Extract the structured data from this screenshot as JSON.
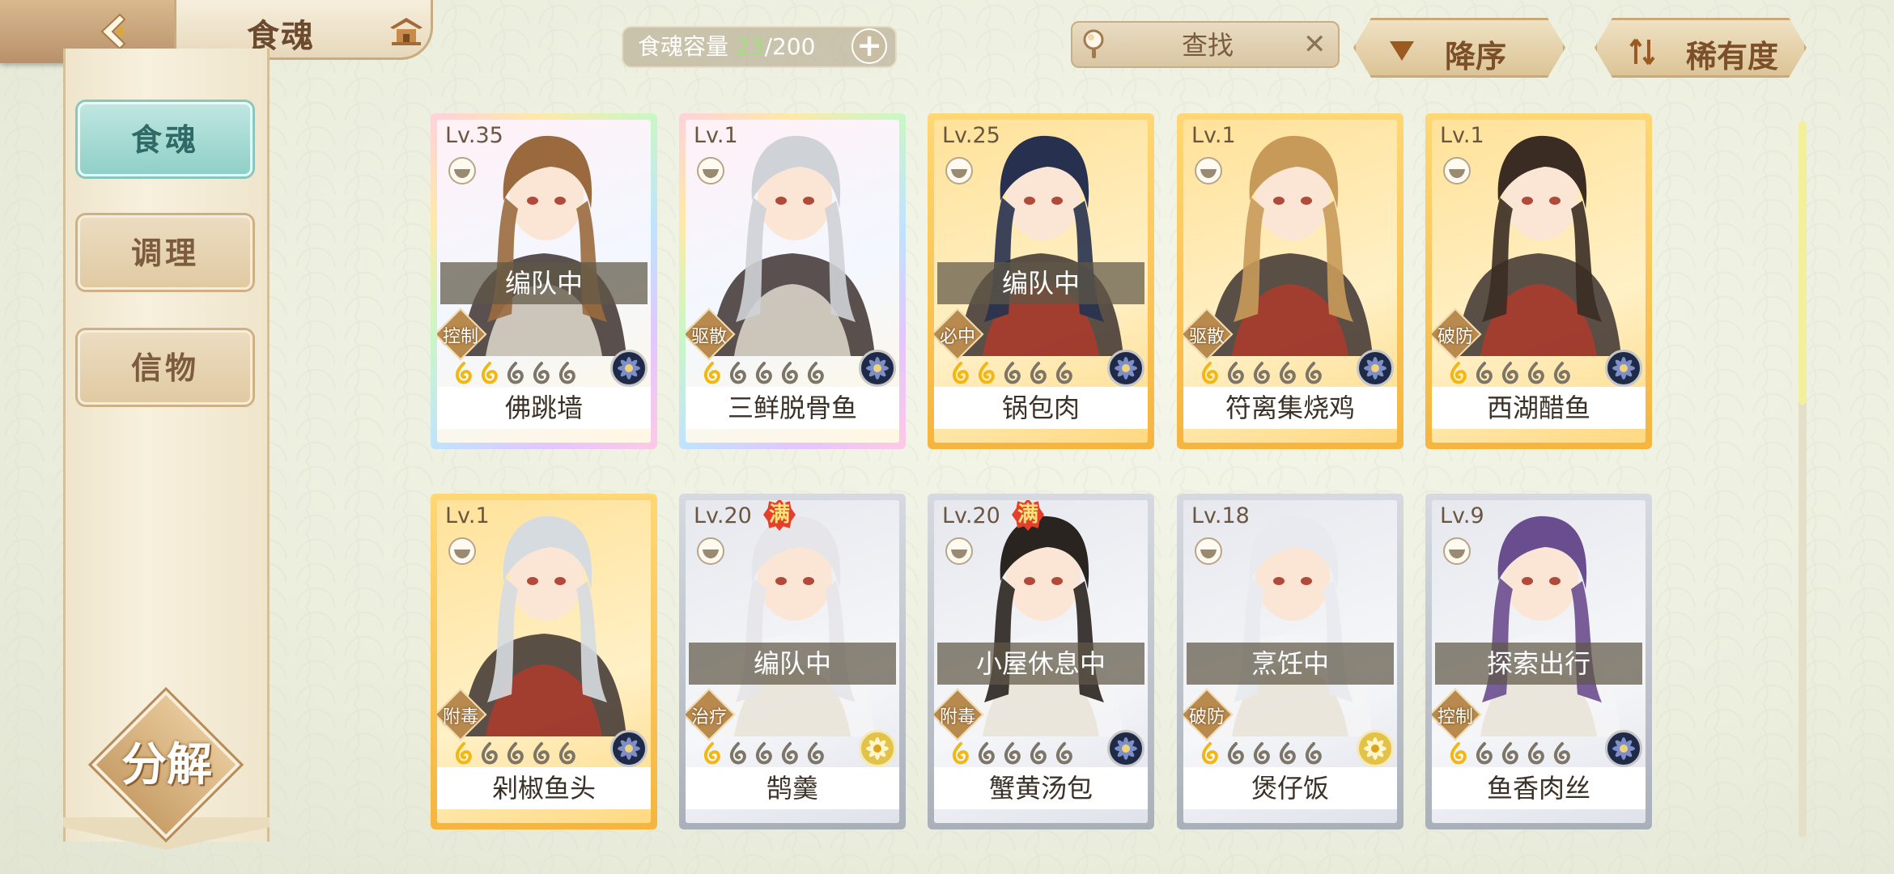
{
  "header": {
    "title": "食魂",
    "capacity_label": "食魂容量",
    "capacity_current": "23",
    "capacity_max": "/200",
    "search_placeholder": "查找",
    "sort_order_label": "降序",
    "sort_key_label": "稀有度"
  },
  "sidebar": {
    "tabs": [
      {
        "label": "食魂",
        "active": true
      },
      {
        "label": "调理",
        "active": false
      },
      {
        "label": "信物",
        "active": false
      }
    ],
    "decompose_label": "分解"
  },
  "colors": {
    "accent_teal": "#8fd0c8",
    "gold_frame": "#f5b53e",
    "capacity_current": "#9fe07a"
  },
  "cards": [
    {
      "level": "Lv.35",
      "name": "佛跳墙",
      "status": "编队中",
      "role": "控制",
      "rarity": "rainbow",
      "stars": 2,
      "full": false,
      "element": "dark",
      "hair": "#9a6a3e"
    },
    {
      "level": "Lv.1",
      "name": "三鲜脱骨鱼",
      "status": "",
      "role": "驱散",
      "rarity": "rainbow",
      "stars": 1,
      "full": false,
      "element": "dark",
      "hair": "#cfd2d6"
    },
    {
      "level": "Lv.25",
      "name": "锅包肉",
      "status": "编队中",
      "role": "必中",
      "rarity": "gold",
      "stars": 2,
      "full": false,
      "element": "dark",
      "hair": "#27314f"
    },
    {
      "level": "Lv.1",
      "name": "符离集烧鸡",
      "status": "",
      "role": "驱散",
      "rarity": "gold",
      "stars": 1,
      "full": false,
      "element": "dark",
      "hair": "#c89a5a"
    },
    {
      "level": "Lv.1",
      "name": "西湖醋鱼",
      "status": "",
      "role": "破防",
      "rarity": "gold",
      "stars": 1,
      "full": false,
      "element": "dark",
      "hair": "#3a2c22"
    },
    {
      "level": "Lv.1",
      "name": "剁椒鱼头",
      "status": "",
      "role": "附毒",
      "rarity": "gold",
      "stars": 1,
      "full": false,
      "element": "dark",
      "hair": "#d6dbe0"
    },
    {
      "level": "Lv.20",
      "name": "鹄羹",
      "status": "编队中",
      "role": "治疗",
      "rarity": "silver",
      "stars": 1,
      "full": true,
      "element": "gold",
      "hair": "#e6e6ea"
    },
    {
      "level": "Lv.20",
      "name": "蟹黄汤包",
      "status": "小屋休息中",
      "role": "附毒",
      "rarity": "silver",
      "stars": 1,
      "full": true,
      "element": "dark",
      "hair": "#2a2420"
    },
    {
      "level": "Lv.18",
      "name": "煲仔饭",
      "status": "烹饪中",
      "role": "破防",
      "rarity": "silver",
      "stars": 1,
      "full": false,
      "element": "gold",
      "hair": "#e9eaf0"
    },
    {
      "level": "Lv.9",
      "name": "鱼香肉丝",
      "status": "探索出行",
      "role": "控制",
      "rarity": "silver",
      "stars": 1,
      "full": false,
      "element": "dark",
      "hair": "#6a4d8e"
    }
  ]
}
